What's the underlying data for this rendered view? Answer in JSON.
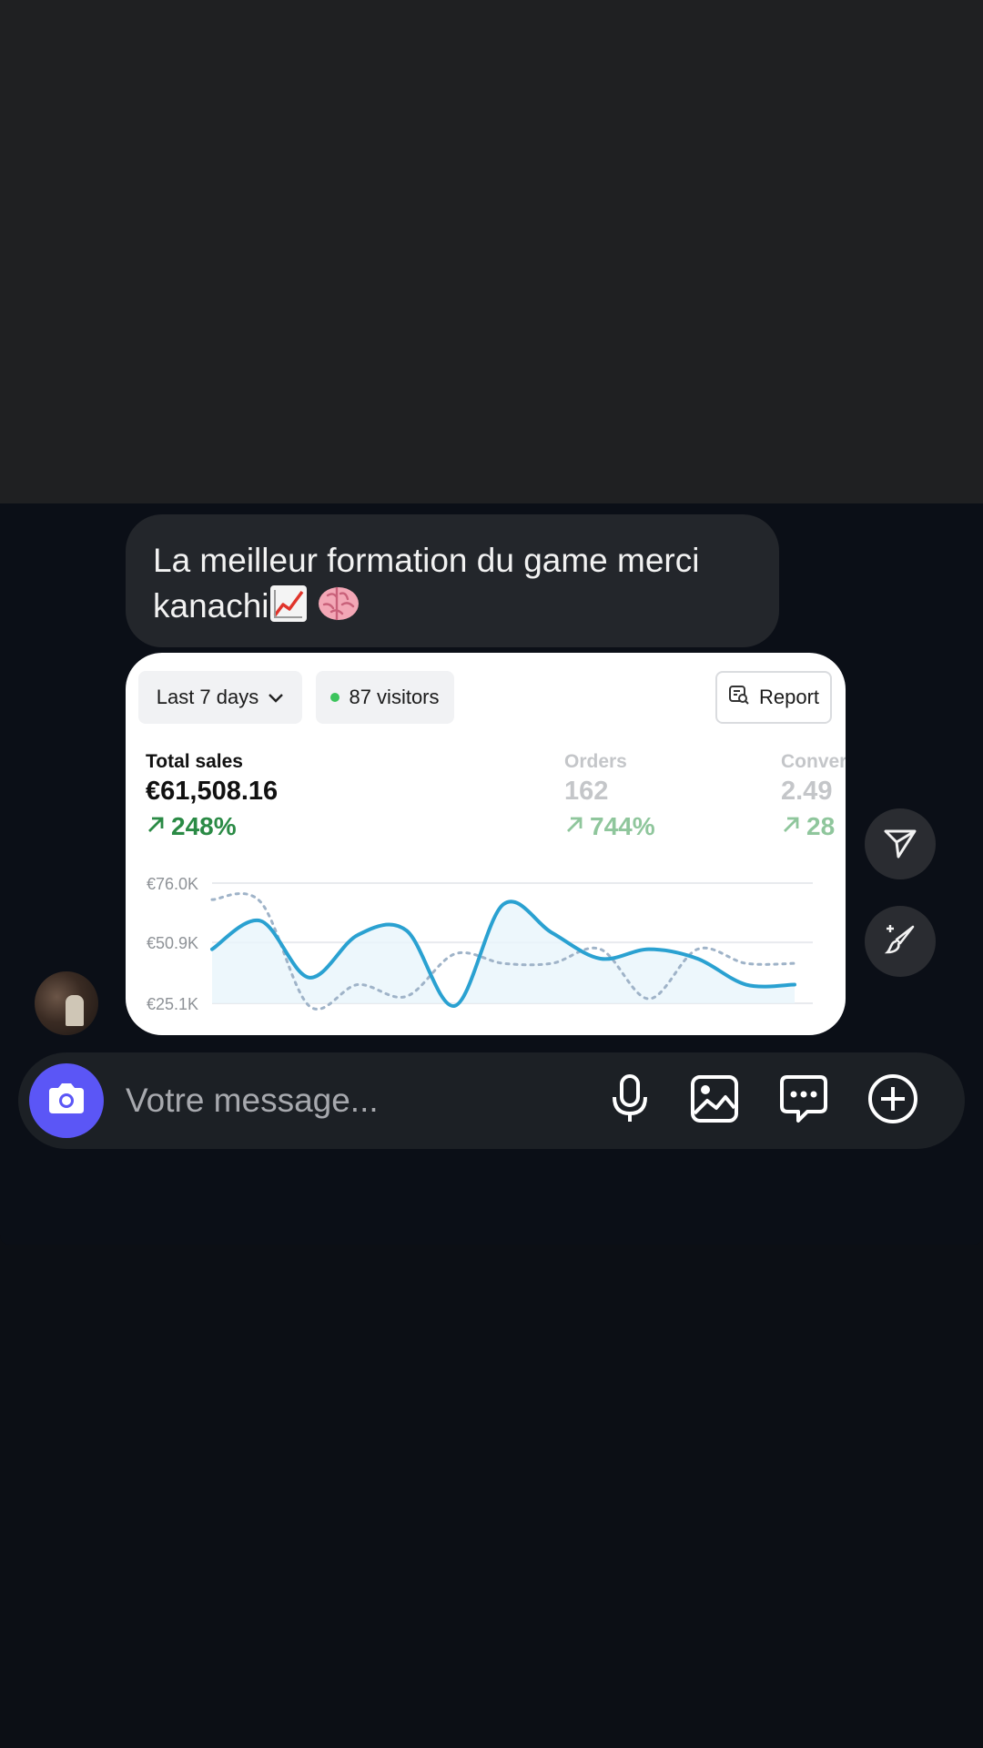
{
  "message": {
    "text": "La meilleur formation du game merci kanachi",
    "emojis": [
      "chart-increasing-emoji",
      "brain-emoji"
    ]
  },
  "dashboard": {
    "period_label": "Last 7 days",
    "visitors_label": "87 visitors",
    "report_label": "Report",
    "metrics": [
      {
        "label": "Total sales",
        "value": "€61,508.16",
        "delta": "248%"
      },
      {
        "label": "Orders",
        "value": "162",
        "delta": "744%"
      },
      {
        "label": "Conver",
        "value": "2.49",
        "delta": "28"
      }
    ]
  },
  "chart_data": {
    "type": "line",
    "y_ticks": [
      "€76.0K",
      "€50.9K",
      "€25.1K"
    ],
    "ylim": [
      25.1,
      76.0
    ],
    "grid": true,
    "x": [
      0,
      1,
      2,
      3,
      4,
      5,
      6,
      7,
      8,
      9,
      10,
      11,
      12
    ],
    "series": [
      {
        "style": "solid",
        "color": "#2aa1d1",
        "values": [
          48,
          60,
          36,
          54,
          56,
          24,
          67,
          55,
          44,
          48,
          44,
          33,
          33
        ]
      },
      {
        "style": "dotted",
        "color": "#9fb3c8",
        "values": [
          69,
          68,
          24,
          33,
          28,
          46,
          42,
          42,
          48,
          27,
          48,
          42,
          42
        ]
      }
    ]
  },
  "input": {
    "placeholder": "Votre message..."
  },
  "icons": {
    "camera": "camera-icon",
    "mic": "microphone-icon",
    "image": "image-icon",
    "chat": "chat-dots-icon",
    "plus": "plus-circle-icon",
    "send": "send-icon",
    "edit": "magic-brush-icon"
  },
  "colors": {
    "accent": "#5b56f6",
    "positive": "#2a8a45",
    "line": "#2aa1d1"
  }
}
